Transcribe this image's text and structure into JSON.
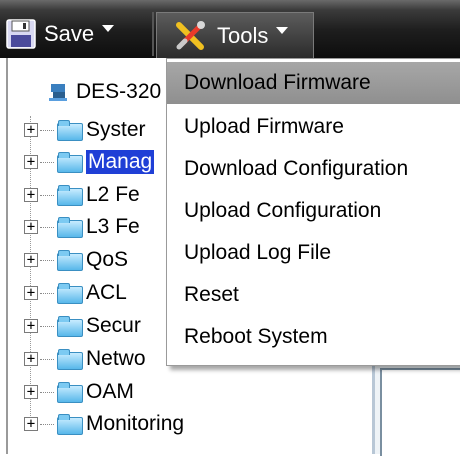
{
  "toolbar": {
    "save_label": "Save",
    "tools_label": "Tools"
  },
  "tree": {
    "root_label": "DES-320",
    "items": [
      {
        "label": "Syster"
      },
      {
        "label": "Manag",
        "selected": true
      },
      {
        "label": "L2 Fe"
      },
      {
        "label": "L3 Fe"
      },
      {
        "label": "QoS"
      },
      {
        "label": "ACL"
      },
      {
        "label": "Secur"
      },
      {
        "label": "Netwo"
      },
      {
        "label": "OAM"
      },
      {
        "label": "Monitoring"
      }
    ],
    "expander_symbol": "+"
  },
  "menu": {
    "items": [
      {
        "label": "Download Firmware",
        "highlighted": true
      },
      {
        "label": "Upload Firmware"
      },
      {
        "label": "Download Configuration"
      },
      {
        "label": "Upload Configuration"
      },
      {
        "label": "Upload Log File"
      },
      {
        "label": "Reset"
      },
      {
        "label": "Reboot System"
      }
    ]
  },
  "colors": {
    "selection": "#1f3fd6",
    "menu_hover": "#9a9a9a",
    "toolbar_bg": "#1e1e1e"
  },
  "icons": {
    "save": "floppy-disk-icon",
    "tools": "tools-icon",
    "folder": "folder-icon",
    "root": "switch-device-icon"
  }
}
